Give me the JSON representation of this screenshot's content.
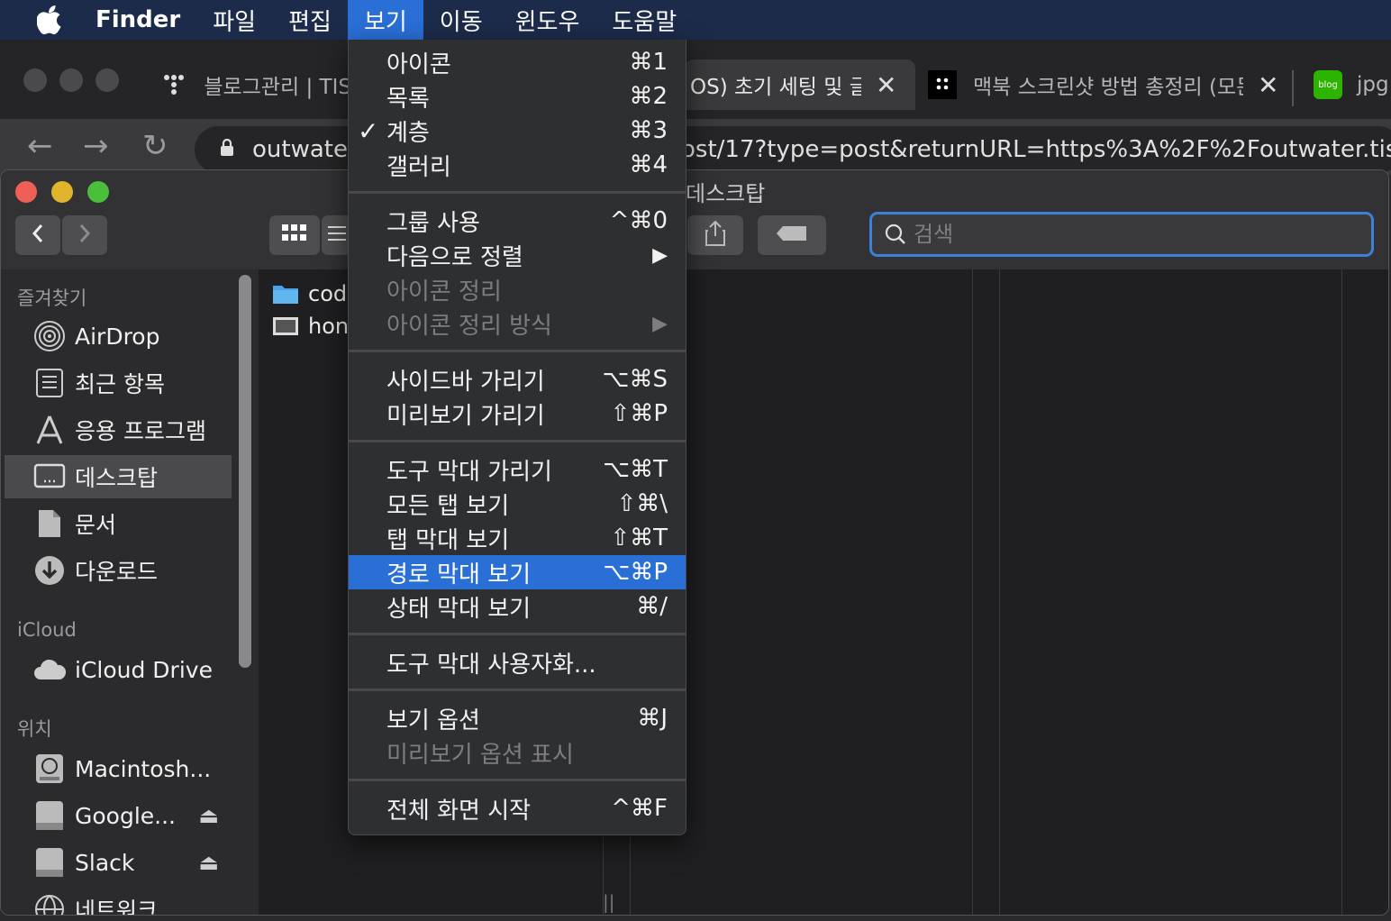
{
  "menubar": {
    "app": "Finder",
    "items": [
      "파일",
      "편집",
      "보기",
      "이동",
      "윈도우",
      "도움말"
    ],
    "active_index": 2
  },
  "browser": {
    "tabs": [
      {
        "title": "블로그관리 | TIS",
        "icon": "tistory-icon"
      },
      {
        "title": "OS) 초기 세팅 및 글",
        "icon": ""
      },
      {
        "title": "맥북 스크린샷 방법 총정리 (모든",
        "icon": "tistory-icon"
      },
      {
        "title": "jpg",
        "icon": "naver-blog-icon"
      }
    ],
    "url_left": "outwate",
    "url_right": "ost/17?type=post&returnURL=https%3A%2F%2Foutwater.tis"
  },
  "finder": {
    "title": "데스크탑",
    "search_placeholder": "검색",
    "sidebar": {
      "sections": {
        "favorites": "즐겨찾기",
        "icloud": "iCloud",
        "locations": "위치"
      },
      "favorites": [
        {
          "label": "AirDrop",
          "icon": "airdrop-icon"
        },
        {
          "label": "최근 항목",
          "icon": "recents-icon"
        },
        {
          "label": "응용 프로그램",
          "icon": "applications-icon"
        },
        {
          "label": "데스크탑",
          "icon": "desktop-icon",
          "selected": true
        },
        {
          "label": "문서",
          "icon": "document-icon"
        },
        {
          "label": "다운로드",
          "icon": "download-icon"
        }
      ],
      "icloud": [
        {
          "label": "iCloud Drive",
          "icon": "cloud-icon"
        }
      ],
      "locations": [
        {
          "label": "Macintosh...",
          "icon": "hard-disk-icon"
        },
        {
          "label": "Google...",
          "icon": "drive-icon",
          "eject": true
        },
        {
          "label": "Slack",
          "icon": "drive-icon",
          "eject": true
        },
        {
          "label": "네트워크",
          "icon": "network-icon"
        }
      ]
    },
    "files": [
      {
        "name": "cod",
        "icon": "folder-icon"
      },
      {
        "name": "hon",
        "icon": "image-file-icon"
      }
    ]
  },
  "view_menu": {
    "groups": [
      [
        {
          "label": "아이콘",
          "shortcut": "⌘1"
        },
        {
          "label": "목록",
          "shortcut": "⌘2"
        },
        {
          "label": "계층",
          "shortcut": "⌘3",
          "checked": true
        },
        {
          "label": "갤러리",
          "shortcut": "⌘4"
        }
      ],
      [
        {
          "label": "그룹 사용",
          "shortcut": "^⌘0"
        },
        {
          "label": "다음으로 정렬",
          "shortcut": "▶"
        },
        {
          "label": "아이콘 정리",
          "shortcut": "",
          "disabled": true
        },
        {
          "label": "아이콘 정리 방식",
          "shortcut": "▶",
          "disabled": true
        }
      ],
      [
        {
          "label": "사이드바 가리기",
          "shortcut": "⌥⌘S"
        },
        {
          "label": "미리보기 가리기",
          "shortcut": "⇧⌘P"
        }
      ],
      [
        {
          "label": "도구 막대 가리기",
          "shortcut": "⌥⌘T"
        },
        {
          "label": "모든 탭 보기",
          "shortcut": "⇧⌘\\"
        },
        {
          "label": "탭 막대 보기",
          "shortcut": "⇧⌘T"
        },
        {
          "label": "경로 막대 보기",
          "shortcut": "⌥⌘P",
          "highlighted": true
        },
        {
          "label": "상태 막대 보기",
          "shortcut": "⌘/"
        }
      ],
      [
        {
          "label": "도구 막대 사용자화...",
          "shortcut": ""
        }
      ],
      [
        {
          "label": "보기 옵션",
          "shortcut": "⌘J"
        },
        {
          "label": "미리보기 옵션 표시",
          "shortcut": "",
          "disabled": true
        }
      ],
      [
        {
          "label": "전체 화면 시작",
          "shortcut": "^⌘F"
        }
      ]
    ]
  },
  "colors": {
    "menubar_bg": "#1d2b4a",
    "accent": "#2a6fd6",
    "traffic_red": "#ed5f57",
    "traffic_yellow": "#e0b52b",
    "traffic_green": "#4bbe3c"
  }
}
